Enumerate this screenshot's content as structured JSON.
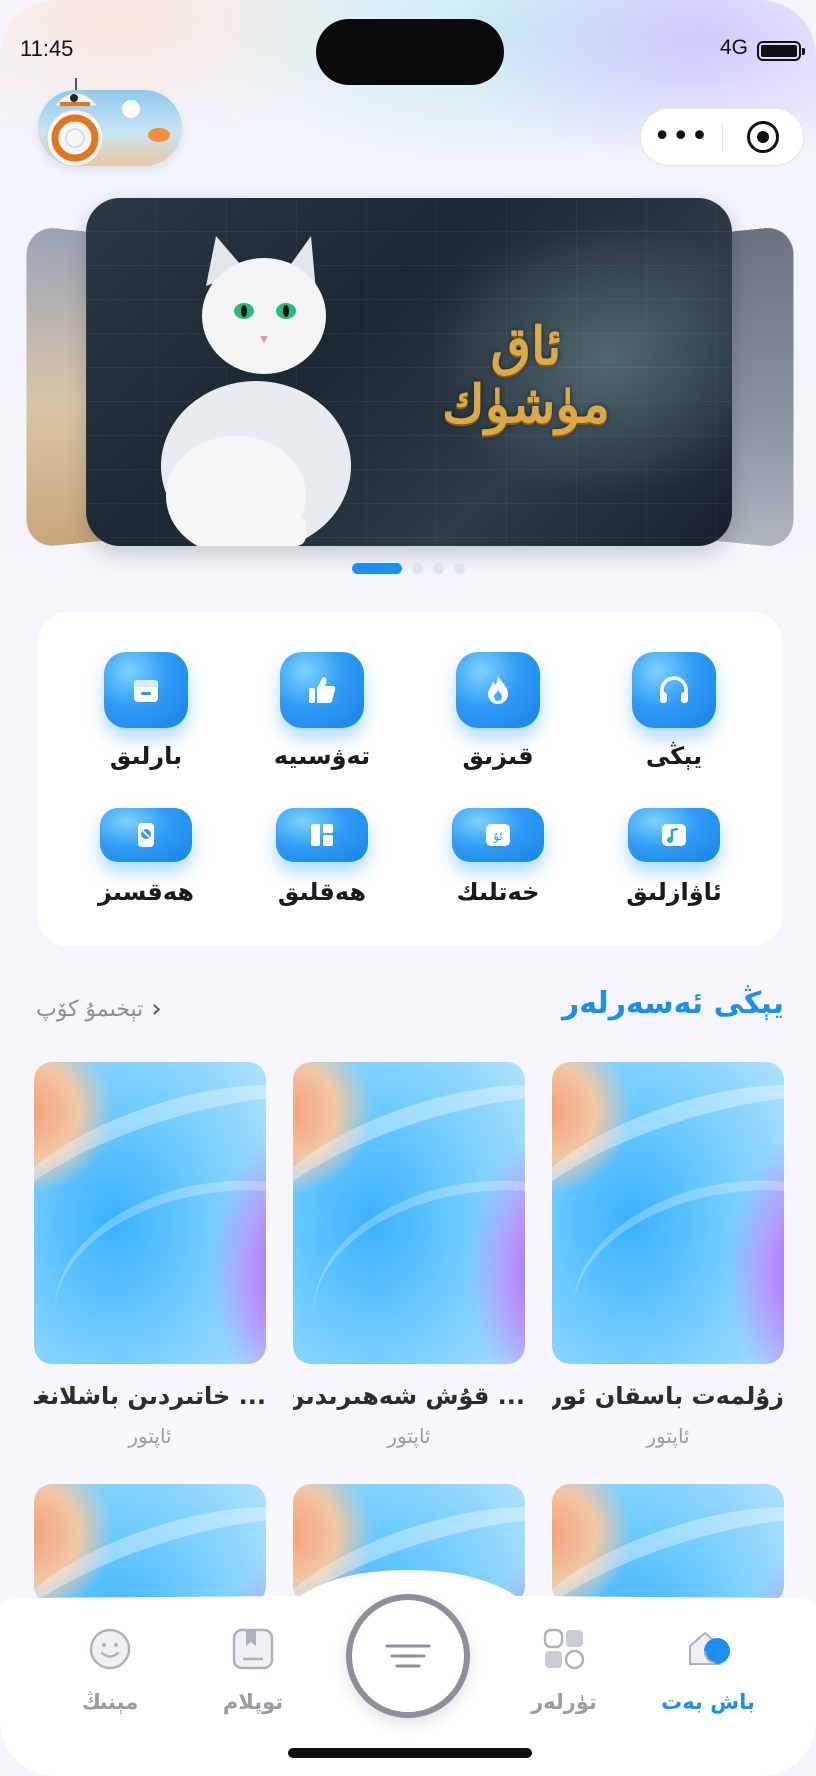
{
  "status": {
    "time": "11:45",
    "network": "4G"
  },
  "header": {
    "menu_icon": "more-dots-icon",
    "close_icon": "target-icon"
  },
  "banner": {
    "title_line1": "ئاق",
    "title_line2": "مۈشۈك",
    "page_count": 4,
    "active_page": 1
  },
  "categories": [
    {
      "label": "يېڭى",
      "icon": "headphones-icon"
    },
    {
      "label": "قىزىق",
      "icon": "flame-icon"
    },
    {
      "label": "تەۋسىيە",
      "icon": "thumbs-up-icon"
    },
    {
      "label": "بارلىق",
      "icon": "inbox-icon"
    },
    {
      "label": "ئاۋازلىق",
      "icon": "music-note-icon"
    },
    {
      "label": "خەتلىك",
      "icon": "text-icon"
    },
    {
      "label": "ھەقلىق",
      "icon": "paid-icon"
    },
    {
      "label": "ھەقسىز",
      "icon": "free-icon"
    }
  ],
  "section": {
    "title": "يېڭى ئەسەرلەر",
    "more_label": "تېخىمۇ كۆپ"
  },
  "books": [
    {
      "title": "زۇلمەت باسقان ئورمان",
      "author": "ئاپتور"
    },
    {
      "title": "... قۇش شەھىرىدىن باش",
      "author": "ئاپتور"
    },
    {
      "title": "... خاتىردىن باشلانغان",
      "author": "ئاپتور"
    }
  ],
  "nav": {
    "home": "باش بەت",
    "categories": "تۈرلەر",
    "collection": "توپلام",
    "mine": "مېنىڭ"
  },
  "colors": {
    "accent": "#1e8ff2",
    "muted": "#9a9ca6"
  }
}
